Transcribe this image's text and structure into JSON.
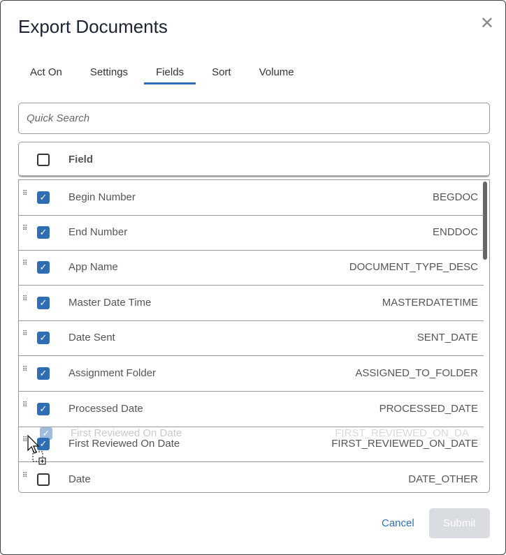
{
  "dialog": {
    "title": "Export Documents",
    "close_icon": "close-icon"
  },
  "tabs": [
    {
      "label": "Act On"
    },
    {
      "label": "Settings"
    },
    {
      "label": "Fields",
      "active": true
    },
    {
      "label": "Sort"
    },
    {
      "label": "Volume"
    }
  ],
  "search": {
    "placeholder": "Quick Search",
    "value": ""
  },
  "table": {
    "header": "Field",
    "header_checked": false,
    "rows": [
      {
        "name": "Begin Number",
        "code": "BEGDOC",
        "checked": true
      },
      {
        "name": "End Number",
        "code": "ENDDOC",
        "checked": true
      },
      {
        "name": "App Name",
        "code": "DOCUMENT_TYPE_DESC",
        "checked": true
      },
      {
        "name": "Master Date Time",
        "code": "MASTERDATETIME",
        "checked": true
      },
      {
        "name": "Date Sent",
        "code": "SENT_DATE",
        "checked": true
      },
      {
        "name": "Assignment Folder",
        "code": "ASSIGNED_TO_FOLDER",
        "checked": true
      },
      {
        "name": "Processed Date",
        "code": "PROCESSED_DATE",
        "checked": true
      },
      {
        "name": "First Reviewed On Date",
        "code": "FIRST_REVIEWED_ON_DATE",
        "checked": true
      },
      {
        "name": "Date",
        "code": "DATE_OTHER",
        "checked": false
      }
    ]
  },
  "drag_ghost": {
    "name": "First Reviewed On Date",
    "code": "FIRST_REVIEWED_ON_DA"
  },
  "footer": {
    "cancel": "Cancel",
    "submit": "Submit"
  },
  "colors": {
    "accent": "#2f6db5",
    "submit_disabled": "#d9dde2"
  }
}
